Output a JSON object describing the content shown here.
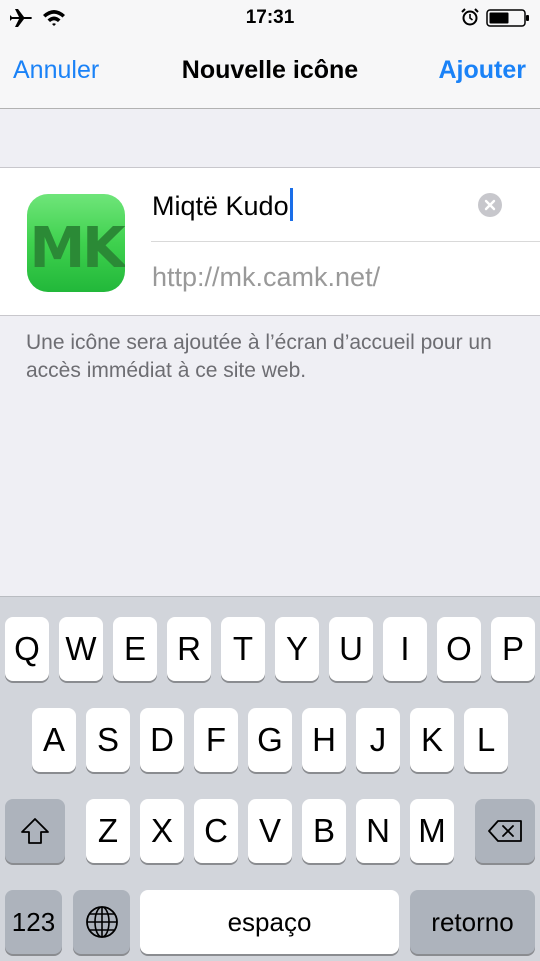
{
  "status_bar": {
    "time": "17:31",
    "icons": [
      "airplane-icon",
      "wifi-icon",
      "alarm-icon",
      "battery-icon"
    ]
  },
  "nav": {
    "cancel": "Annuler",
    "title": "Nouvelle icône",
    "add": "Ajouter"
  },
  "form": {
    "icon_text": "MK",
    "title_value": "Miqtë Kudo",
    "url_value": "http://mk.camk.net/",
    "clear_icon": "clear-icon"
  },
  "note": "Une icône sera ajoutée à l’écran d’accueil pour un accès immédiat à ce site web.",
  "keyboard": {
    "row1": [
      "Q",
      "W",
      "E",
      "R",
      "T",
      "Y",
      "U",
      "I",
      "O",
      "P"
    ],
    "row2": [
      "A",
      "S",
      "D",
      "F",
      "G",
      "H",
      "J",
      "K",
      "L"
    ],
    "row3": [
      "Z",
      "X",
      "C",
      "V",
      "B",
      "N",
      "M"
    ],
    "numbers": "123",
    "space": "espaço",
    "return": "retorno",
    "shift_icon": "shift-icon",
    "globe_icon": "globe-icon",
    "delete_icon": "delete-icon"
  },
  "colors": {
    "accent": "#1a82f7",
    "keyboard_bg": "#d2d5db",
    "page_bg": "#efeff4"
  }
}
